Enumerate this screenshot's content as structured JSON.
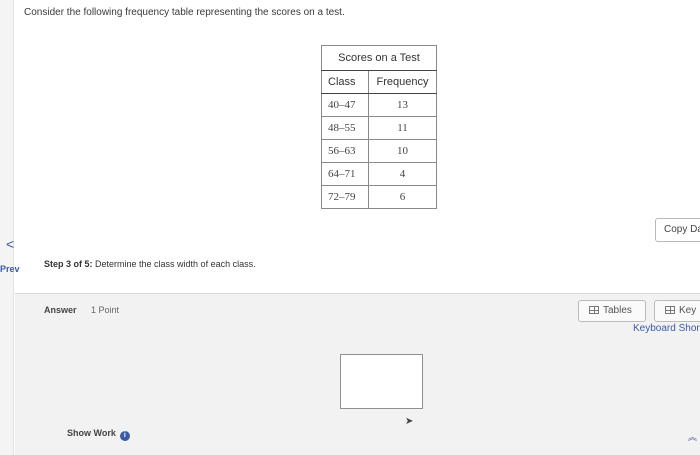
{
  "question": {
    "prompt": "Consider the following frequency table representing the scores on a test.",
    "step_label": "Step 3 of 5:",
    "step_text": " Determine the class width of each class."
  },
  "table": {
    "caption": "Scores on a Test",
    "headers": [
      "Class",
      "Frequency"
    ],
    "rows": [
      [
        "40–47",
        "13"
      ],
      [
        "48–55",
        "11"
      ],
      [
        "56–63",
        "10"
      ],
      [
        "64–71",
        "4"
      ],
      [
        "72–79",
        "6"
      ]
    ]
  },
  "nav": {
    "prev_arrow": "<",
    "prev_label": "Prev"
  },
  "toolbar": {
    "copy_label": "Copy Da",
    "tables_label": "Tables",
    "keypad_label": "Key",
    "shortcuts_label": "Keyboard Shor"
  },
  "answer": {
    "label": "Answer",
    "points": "1 Point",
    "show_work": "Show Work",
    "info_glyph": "i"
  },
  "icons": {
    "tables": "table-icon",
    "keypad": "keypad-icon",
    "info": "info-icon",
    "scroll_up": "chevron-up-icon",
    "cursor": "mouse-pointer-icon"
  }
}
